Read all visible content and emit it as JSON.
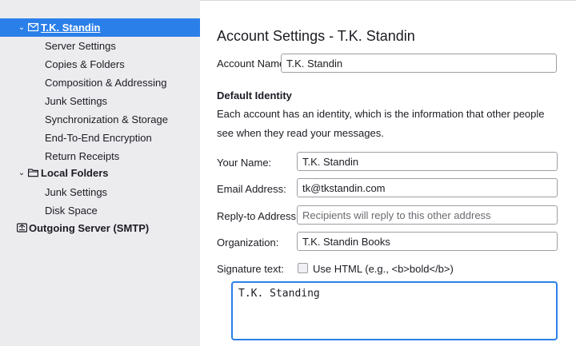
{
  "colors": {
    "accent": "#2b7fe8",
    "sidebar_bg": "#ececef",
    "border": "#9e9ea6"
  },
  "sidebar": {
    "account": {
      "label": "T.K. Standin",
      "icon": "envelope-icon",
      "expanded": true
    },
    "account_items": [
      "Server Settings",
      "Copies & Folders",
      "Composition & Addressing",
      "Junk Settings",
      "Synchronization & Storage",
      "End-To-End Encryption",
      "Return Receipts"
    ],
    "local_folders": {
      "label": "Local Folders",
      "icon": "folder-icon",
      "expanded": true
    },
    "local_items": [
      "Junk Settings",
      "Disk Space"
    ],
    "outgoing": {
      "label": "Outgoing Server (SMTP)",
      "icon": "outbox-icon"
    }
  },
  "main": {
    "title": "Account Settings - T.K. Standin",
    "account_name": {
      "label": "Account Name:",
      "value": "T.K. Standin"
    },
    "default_identity": {
      "heading": "Default Identity",
      "description": "Each account has an identity, which is the information that other people see when they read your messages."
    },
    "your_name": {
      "label": "Your Name:",
      "value": "T.K. Standin"
    },
    "email": {
      "label": "Email Address:",
      "value": "tk@tkstandin.com"
    },
    "reply_to": {
      "label": "Reply-to Address:",
      "value": "",
      "placeholder": "Recipients will reply to this other address"
    },
    "organization": {
      "label": "Organization:",
      "value": "T.K. Standin Books"
    },
    "signature": {
      "label": "Signature text:",
      "use_html_label": "Use HTML (e.g., <b>bold</b>)",
      "use_html_checked": false,
      "text": "T.K. Standing"
    }
  }
}
